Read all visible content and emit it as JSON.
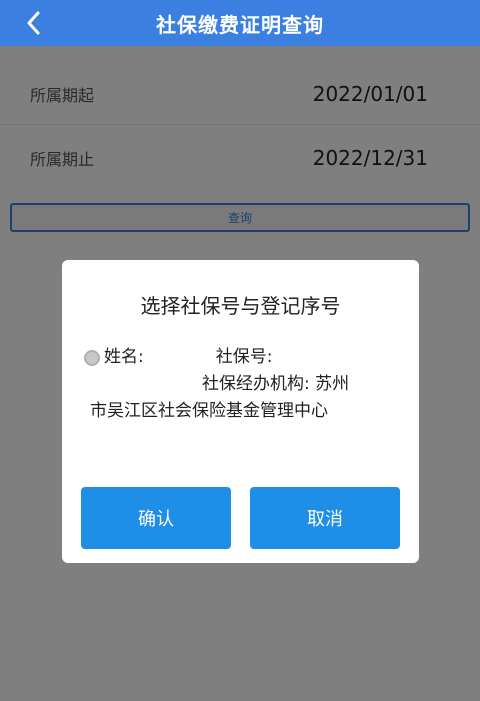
{
  "header": {
    "title": "社保缴费证明查询",
    "back_icon": "chevron-left-icon",
    "background": "#3b7fe0"
  },
  "form": {
    "period_start": {
      "label": "所属期起",
      "value": "2022/01/01"
    },
    "period_end": {
      "label": "所属期止",
      "value": "2022/12/31"
    },
    "query_label": "查询"
  },
  "dialog": {
    "title": "选择社保号与登记序号",
    "option": {
      "name_label": "姓名:",
      "ssn_label": "社保号:",
      "agency_line1": "社保经办机构: 苏州",
      "agency_line2": "市吴江区社会保险基金管理中心"
    },
    "confirm_label": "确认",
    "cancel_label": "取消",
    "button_color": "#1e8ee6"
  }
}
